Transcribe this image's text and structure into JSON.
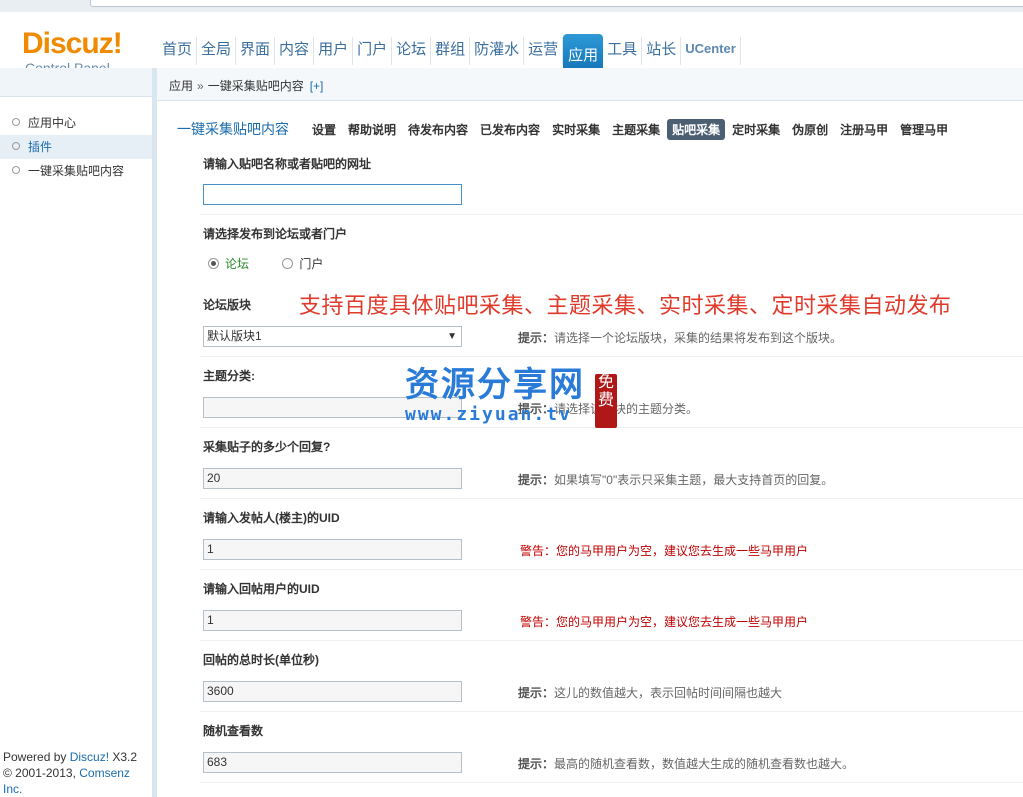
{
  "header": {
    "logo_brand": "Discuz!",
    "logo_sub": "Control Panel",
    "nav": [
      {
        "label": "首页"
      },
      {
        "label": "全局"
      },
      {
        "label": "界面"
      },
      {
        "label": "内容"
      },
      {
        "label": "用户"
      },
      {
        "label": "门户"
      },
      {
        "label": "论坛"
      },
      {
        "label": "群组"
      },
      {
        "label": "防灌水"
      },
      {
        "label": "运营"
      },
      {
        "label": "应用",
        "active": true
      },
      {
        "label": "工具"
      },
      {
        "label": "站长"
      },
      {
        "label": "UCenter"
      }
    ]
  },
  "breadcrumb": {
    "root": "应用",
    "sep": "»",
    "current": "一键采集贴吧内容",
    "plus": "[+]"
  },
  "sidebar": {
    "items": [
      {
        "label": "应用中心"
      },
      {
        "label": "插件",
        "active": true
      },
      {
        "label": "一键采集贴吧内容"
      }
    ],
    "footer_powered": "Powered by ",
    "footer_brand": "Discuz!",
    "footer_version": " X3.2",
    "footer_copy": "© 2001-2013, ",
    "footer_company": "Comsenz Inc."
  },
  "subnav": {
    "title": "一键采集贴吧内容",
    "tabs": [
      {
        "label": "设置"
      },
      {
        "label": "帮助说明"
      },
      {
        "label": "待发布内容"
      },
      {
        "label": "已发布内容"
      },
      {
        "label": "实时采集"
      },
      {
        "label": "主题采集"
      },
      {
        "label": "贴吧采集",
        "active": true
      },
      {
        "label": "定时采集"
      },
      {
        "label": "伪原创"
      },
      {
        "label": "注册马甲"
      },
      {
        "label": "管理马甲"
      }
    ]
  },
  "form": {
    "tieba_label": "请输入贴吧名称或者贴吧的网址",
    "tieba_value": "",
    "publish_label": "请选择发布到论坛或者门户",
    "radio_forum": "论坛",
    "radio_portal": "门户",
    "board_label": "论坛版块",
    "board_value": "默认版块1",
    "board_tip_prefix": "提示：",
    "board_tip": "请选择一个论坛版块，采集的结果将发布到这个版块。",
    "category_label": "主题分类:",
    "category_tip_prefix": "提示：",
    "category_tip": "请选择该版块的主题分类。",
    "replies_label": "采集贴子的多少个回复?",
    "replies_value": "20",
    "replies_tip_prefix": "提示：",
    "replies_tip": "如果填写\"0\"表示只采集主题，最大支持首页的回复。",
    "poster_label": "请输入发帖人(楼主)的UID",
    "poster_value": "1",
    "poster_warn": "警告：您的马甲用户为空，建议您去生成一些马甲用户",
    "replier_label": "请输入回帖用户的UID",
    "replier_value": "1",
    "replier_warn": "警告：您的马甲用户为空，建议您去生成一些马甲用户",
    "duration_label": "回帖的总时长(单位秒)",
    "duration_value": "3600",
    "duration_tip_prefix": "提示：",
    "duration_tip": "这儿的数值越大，表示回帖时间间隔也越大",
    "views_label": "随机查看数",
    "views_value": "683",
    "views_tip_prefix": "提示：",
    "views_tip": "最高的随机查看数，数值越大生成的随机查看数也越大。"
  },
  "overlay_caption": "支持百度具体贴吧采集、主题采集、实时采集、定时采集自动发布",
  "watermark": {
    "title": "资源分享网",
    "url": "www.ziyuan.tv",
    "seal": "免费"
  }
}
